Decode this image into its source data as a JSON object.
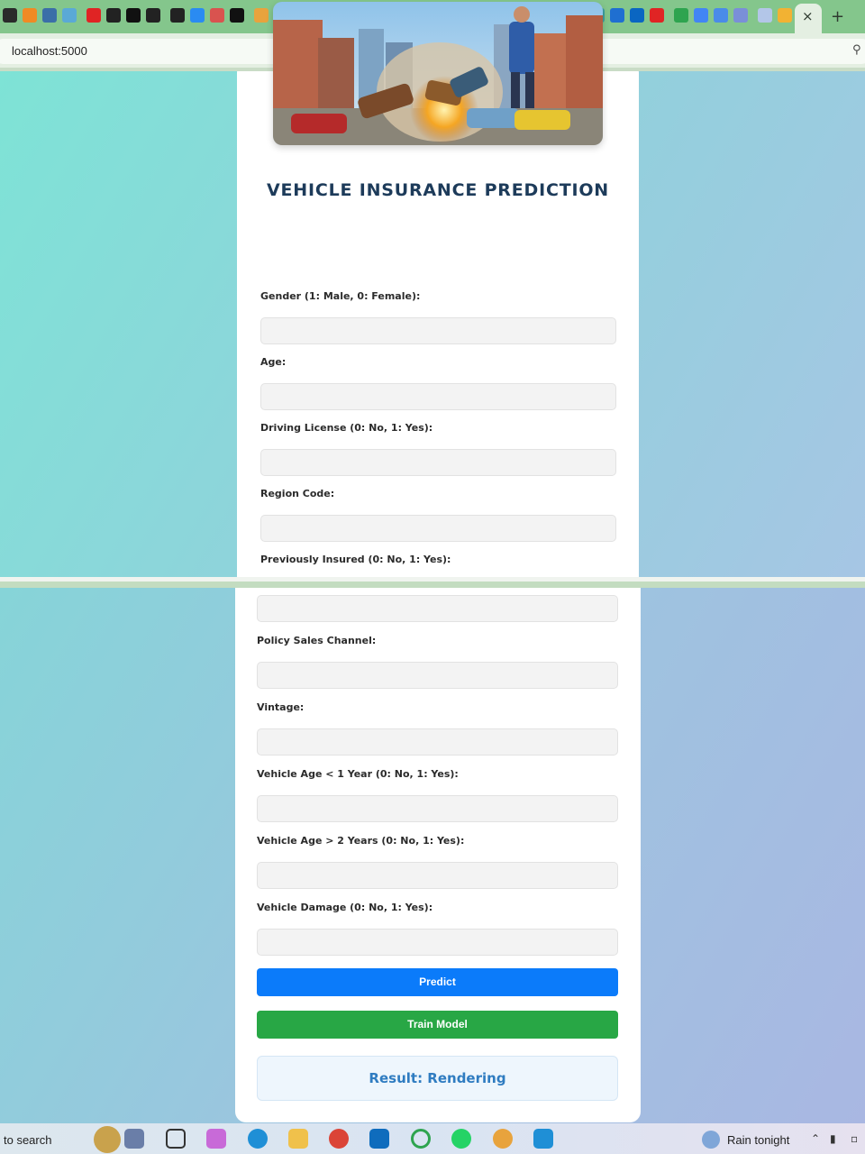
{
  "browser": {
    "url": "localhost:5000",
    "tab_close": "×",
    "new_tab": "+"
  },
  "page": {
    "title": "VEHICLE INSURANCE PREDICTION",
    "fields_top": [
      {
        "label": "Gender (1: Male, 0: Female):",
        "value": ""
      },
      {
        "label": "Age:",
        "value": ""
      },
      {
        "label": "Driving License (0: No, 1: Yes):",
        "value": ""
      },
      {
        "label": "Region Code:",
        "value": ""
      },
      {
        "label": "Previously Insured (0: No, 1: Yes):",
        "value": ""
      }
    ],
    "fields_bottom": [
      {
        "label": "Policy Sales Channel:",
        "value": ""
      },
      {
        "label": "Vintage:",
        "value": ""
      },
      {
        "label": "Vehicle Age < 1 Year (0: No, 1: Yes):",
        "value": ""
      },
      {
        "label": "Vehicle Age > 2 Years (0: No, 1: Yes):",
        "value": ""
      },
      {
        "label": "Vehicle Damage (0: No, 1: Yes):",
        "value": ""
      }
    ],
    "buttons": {
      "predict": "Predict",
      "train": "Train Model"
    },
    "result": "Result: Rendering"
  },
  "taskbar": {
    "search": "to search",
    "weather": "Rain tonight"
  },
  "colors": {
    "predict_button": "#0b7bfa",
    "train_button": "#28a745",
    "title": "#1d3b5a",
    "result_text": "#2f7cc1"
  }
}
